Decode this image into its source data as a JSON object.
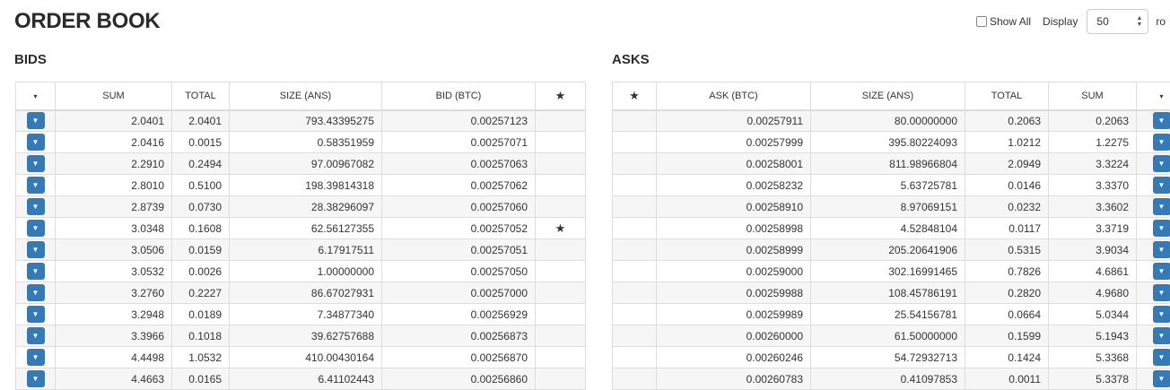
{
  "page": {
    "title": "ORDER BOOK",
    "show_all_label": "Show All",
    "display_label": "Display",
    "rows_value": "50",
    "rows_suffix": "ro"
  },
  "bids": {
    "title": "BIDS",
    "headers": {
      "menu": "▾",
      "sum": "SUM",
      "total": "TOTAL",
      "size": "SIZE (ANS)",
      "price": "BID (BTC)",
      "star": "★"
    },
    "rows": [
      {
        "sum": "2.0401",
        "total": "2.0401",
        "size": "793.43395275",
        "price": "0.00257123",
        "star": ""
      },
      {
        "sum": "2.0416",
        "total": "0.0015",
        "size": "0.58351959",
        "price": "0.00257071",
        "star": ""
      },
      {
        "sum": "2.2910",
        "total": "0.2494",
        "size": "97.00967082",
        "price": "0.00257063",
        "star": ""
      },
      {
        "sum": "2.8010",
        "total": "0.5100",
        "size": "198.39814318",
        "price": "0.00257062",
        "star": ""
      },
      {
        "sum": "2.8739",
        "total": "0.0730",
        "size": "28.38296097",
        "price": "0.00257060",
        "star": ""
      },
      {
        "sum": "3.0348",
        "total": "0.1608",
        "size": "62.56127355",
        "price": "0.00257052",
        "star": "★"
      },
      {
        "sum": "3.0506",
        "total": "0.0159",
        "size": "6.17917511",
        "price": "0.00257051",
        "star": ""
      },
      {
        "sum": "3.0532",
        "total": "0.0026",
        "size": "1.00000000",
        "price": "0.00257050",
        "star": ""
      },
      {
        "sum": "3.2760",
        "total": "0.2227",
        "size": "86.67027931",
        "price": "0.00257000",
        "star": ""
      },
      {
        "sum": "3.2948",
        "total": "0.0189",
        "size": "7.34877340",
        "price": "0.00256929",
        "star": ""
      },
      {
        "sum": "3.3966",
        "total": "0.1018",
        "size": "39.62757688",
        "price": "0.00256873",
        "star": ""
      },
      {
        "sum": "4.4498",
        "total": "1.0532",
        "size": "410.00430164",
        "price": "0.00256870",
        "star": ""
      },
      {
        "sum": "4.4663",
        "total": "0.0165",
        "size": "6.41102443",
        "price": "0.00256860",
        "star": ""
      }
    ]
  },
  "asks": {
    "title": "ASKS",
    "headers": {
      "star": "★",
      "price": "ASK (BTC)",
      "size": "SIZE (ANS)",
      "total": "TOTAL",
      "sum": "SUM",
      "menu": "▾"
    },
    "rows": [
      {
        "price": "0.00257911",
        "size": "80.00000000",
        "total": "0.2063",
        "sum": "0.2063"
      },
      {
        "price": "0.00257999",
        "size": "395.80224093",
        "total": "1.0212",
        "sum": "1.2275"
      },
      {
        "price": "0.00258001",
        "size": "811.98966804",
        "total": "2.0949",
        "sum": "3.3224"
      },
      {
        "price": "0.00258232",
        "size": "5.63725781",
        "total": "0.0146",
        "sum": "3.3370"
      },
      {
        "price": "0.00258910",
        "size": "8.97069151",
        "total": "0.0232",
        "sum": "3.3602"
      },
      {
        "price": "0.00258998",
        "size": "4.52848104",
        "total": "0.0117",
        "sum": "3.3719"
      },
      {
        "price": "0.00258999",
        "size": "205.20641906",
        "total": "0.5315",
        "sum": "3.9034"
      },
      {
        "price": "0.00259000",
        "size": "302.16991465",
        "total": "0.7826",
        "sum": "4.6861"
      },
      {
        "price": "0.00259988",
        "size": "108.45786191",
        "total": "0.2820",
        "sum": "4.9680"
      },
      {
        "price": "0.00259989",
        "size": "25.54156781",
        "total": "0.0664",
        "sum": "5.0344"
      },
      {
        "price": "0.00260000",
        "size": "61.50000000",
        "total": "0.1599",
        "sum": "5.1943"
      },
      {
        "price": "0.00260246",
        "size": "54.72932713",
        "total": "0.1424",
        "sum": "5.3368"
      },
      {
        "price": "0.00260783",
        "size": "0.41097853",
        "total": "0.0011",
        "sum": "5.3378"
      }
    ]
  },
  "icons": {
    "dropdown": "▼",
    "select_arrows_up": "▲",
    "select_arrows_down": "▼"
  },
  "colors": {
    "button": "#337ab7",
    "stripe": "#f6f6f6",
    "border": "#dddddd"
  }
}
